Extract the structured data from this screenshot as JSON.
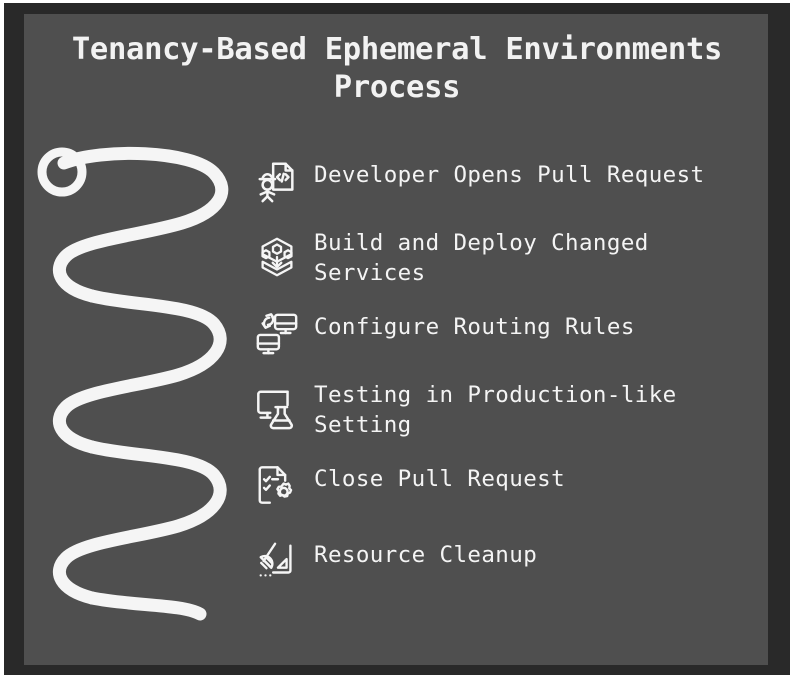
{
  "graphic": {
    "title": "Tenancy-Based Ephemeral Environments\nProcess",
    "background_color": "#4f4f4f",
    "frame_color": "#292929",
    "text_color": "#f2f2f2",
    "accent_color": "#ffffff",
    "decoration": {
      "name": "coil-spring",
      "coils": 6
    }
  },
  "steps": [
    {
      "index": 1,
      "label": "Developer Opens Pull Request",
      "icon": "developer-code-document-icon"
    },
    {
      "index": 2,
      "label": "Build and Deploy Changed\nServices",
      "icon": "hexagon-cluster-deploy-icon"
    },
    {
      "index": 3,
      "label": "Configure Routing Rules",
      "icon": "two-monitors-swap-icon"
    },
    {
      "index": 4,
      "label": "Testing in Production-like\nSetting",
      "icon": "monitor-flask-icon"
    },
    {
      "index": 5,
      "label": "Close Pull Request",
      "icon": "checklist-gear-icon"
    },
    {
      "index": 6,
      "label": "Resource Cleanup",
      "icon": "broom-dustpan-icon"
    }
  ]
}
